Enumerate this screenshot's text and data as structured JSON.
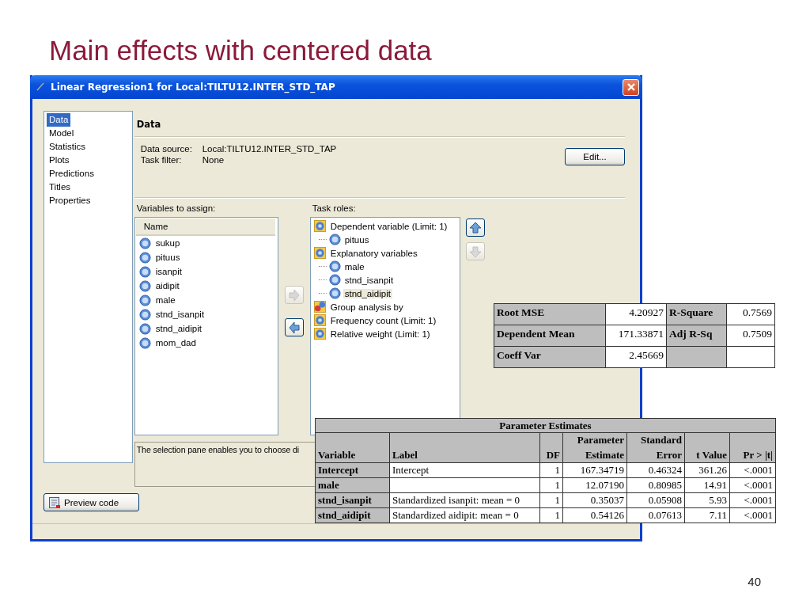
{
  "slide": {
    "title": "Main effects with centered data",
    "page_number": "40"
  },
  "window": {
    "title": "Linear Regression1 for Local:TILTU12.INTER_STD_TAP"
  },
  "nav": [
    {
      "label": "Data",
      "selected": true
    },
    {
      "label": "Model",
      "selected": false
    },
    {
      "label": "Statistics",
      "selected": false
    },
    {
      "label": "Plots",
      "selected": false
    },
    {
      "label": "Predictions",
      "selected": false
    },
    {
      "label": "Titles",
      "selected": false
    },
    {
      "label": "Properties",
      "selected": false
    }
  ],
  "section_title": "Data",
  "data_info": [
    {
      "label": "Data source:",
      "value": "Local:TILTU12.INTER_STD_TAP"
    },
    {
      "label": "Task filter:",
      "value": "None"
    }
  ],
  "edit_button": "Edit...",
  "variables": {
    "label": "Variables to assign:",
    "column": "Name",
    "items": [
      {
        "name": "sukup",
        "selected": false
      },
      {
        "name": "pituus",
        "selected": false
      },
      {
        "name": "isanpit",
        "selected": false
      },
      {
        "name": "aidipit",
        "selected": false
      },
      {
        "name": "male",
        "selected": false
      },
      {
        "name": "stnd_isanpit",
        "selected": false
      },
      {
        "name": "stnd_aidipit",
        "selected": false
      },
      {
        "name": "mom_dad",
        "selected": false
      }
    ]
  },
  "move_buttons": [
    {
      "kind": "right",
      "disabled": true
    },
    {
      "kind": "left",
      "disabled": false
    }
  ],
  "task_roles": {
    "label": "Task roles:",
    "roles": [
      {
        "name": "Dependent variable  (Limit: 1)",
        "kind": "variable",
        "children": [
          {
            "name": "pituus",
            "selected": false
          }
        ]
      },
      {
        "name": "Explanatory variables",
        "kind": "variable",
        "children": [
          {
            "name": "male",
            "selected": false
          },
          {
            "name": "stnd_isanpit",
            "selected": false
          },
          {
            "name": "stnd_aidipit",
            "selected": true
          }
        ]
      },
      {
        "name": "Group analysis by",
        "kind": "group"
      },
      {
        "name": "Frequency count  (Limit: 1)",
        "kind": "variable"
      },
      {
        "name": "Relative weight  (Limit: 1)",
        "kind": "variable"
      }
    ]
  },
  "order_buttons": [
    {
      "kind": "up",
      "disabled": false
    },
    {
      "kind": "down",
      "disabled": true
    }
  ],
  "help_text": "The selection pane enables you to choose di",
  "preview_button": "Preview code",
  "fit_stats": [
    [
      "Root MSE",
      "4.20927",
      "R-Square",
      "0.7569"
    ],
    [
      "Dependent Mean",
      "171.33871",
      "Adj R-Sq",
      "0.7509"
    ],
    [
      "Coeff Var",
      "2.45669"
    ]
  ],
  "param_estimates": {
    "title": "Parameter Estimates",
    "header_rows": [
      [
        null,
        null,
        null,
        "Parameter",
        "Standard",
        null,
        null
      ],
      [
        "Variable",
        "Label",
        "DF",
        "Estimate",
        "Error",
        "t Value",
        "Pr > |t|"
      ]
    ],
    "rows": [
      [
        "Intercept",
        "Intercept",
        "1",
        "167.34719",
        "0.46324",
        "361.26",
        "<.0001"
      ],
      [
        "male",
        null,
        "1",
        "12.07190",
        "0.80985",
        "14.91",
        "<.0001"
      ],
      [
        "stnd_isanpit",
        "Standardized isanpit: mean = 0",
        "1",
        "0.35037",
        "0.05908",
        "5.93",
        "<.0001"
      ],
      [
        "stnd_aidipit",
        "Standardized aidipit: mean = 0",
        "1",
        "0.54126",
        "0.07613",
        "7.11",
        "<.0001"
      ]
    ]
  }
}
